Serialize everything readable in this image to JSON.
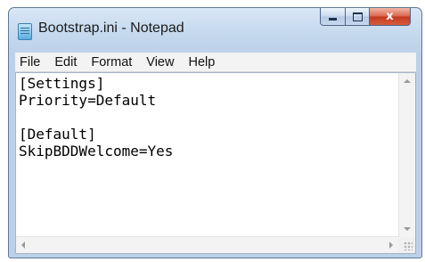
{
  "window": {
    "title": "Bootstrap.ini - Notepad",
    "app_icon": "notepad-icon",
    "caption_buttons": {
      "minimize": "minimize-icon",
      "maximize": "maximize-icon",
      "close_glyph": "x"
    }
  },
  "menubar": {
    "items": [
      {
        "label": "File"
      },
      {
        "label": "Edit"
      },
      {
        "label": "Format"
      },
      {
        "label": "View"
      },
      {
        "label": "Help"
      }
    ]
  },
  "editor": {
    "content": "[Settings]\nPriority=Default\n\n[Default]\nSkipBDDWelcome=Yes"
  },
  "colors": {
    "titlebar": "#c4d8ee",
    "close_button": "#c2391d",
    "menubar": "#f3f3f3",
    "editor_background": "#ffffff"
  }
}
